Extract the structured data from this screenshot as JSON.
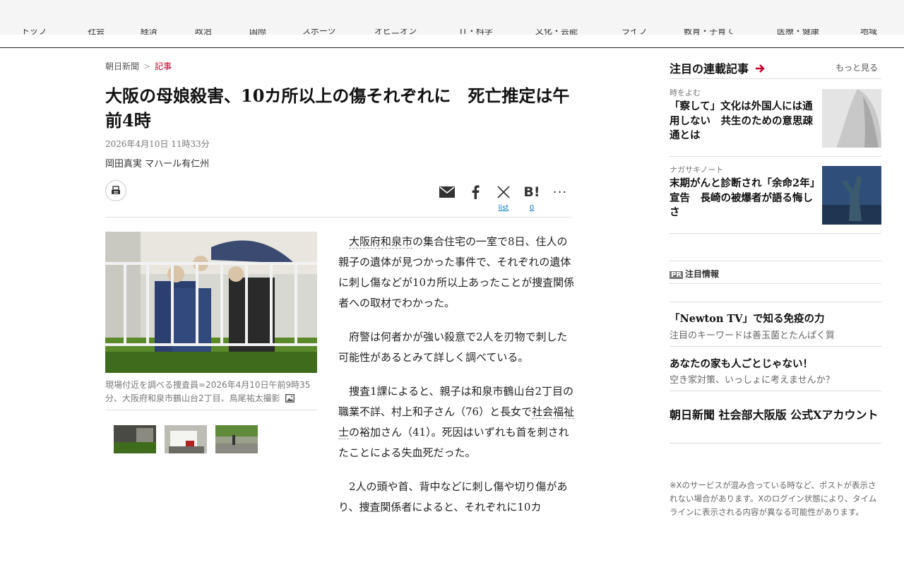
{
  "nav": {
    "items": [
      "トップ",
      "社会",
      "経済",
      "政治",
      "国際",
      "スポーツ",
      "オピニオン",
      "IT・科学",
      "文化・芸能",
      "ライフ",
      "教育・子育て",
      "医療・健康",
      "地域"
    ]
  },
  "breadcrumb": {
    "home": "朝日新聞",
    "separator": ">",
    "current": "記事"
  },
  "article": {
    "headline": "大阪の母娘殺害、10カ所以上の傷それぞれに　死亡推定は午前4時",
    "date": "2026年4月10日 11時33分",
    "authors": "岡田真実 マハール有仁州",
    "share": {
      "list_label": "list",
      "hatena_count": "0"
    },
    "photo_caption": "現場付近を調べる捜査員=2026年4月10日午前9時35分、大阪府和泉市鶴山台2丁目、鳥尾祐太撮影",
    "paragraphs": [
      {
        "link": "大阪府和泉市",
        "text": "の集合住宅の一室で8日、住人の親子の遺体が見つかった事件で、それぞれの遺体に刺し傷などが10カ所以上あったことが捜査関係者への取材でわかった。"
      },
      {
        "link": "",
        "text": "府警は何者かが強い殺意で2人を刃物で刺した可能性があるとみて詳しく調べている。"
      },
      {
        "pre": "捜査1課によると、親子は和泉市鶴山台2丁目の職業不詳、村上和子さん（76）と長女で",
        "link": "社会福祉士",
        "text": "の裕加さん（41）。死因はいずれも首を刺されたことによる失血死だった。"
      },
      {
        "link": "",
        "text": "2人の頭や首、背中などに刺し傷や切り傷があり、捜査関係者によると、それぞれに10カ"
      }
    ]
  },
  "sidebar": {
    "header": "注目の連載記事",
    "more": "もっと見る",
    "items": [
      {
        "kicker": "時をよむ",
        "title": "「察して」文化は外国人には通用しない　共生のための意思疎通とは"
      },
      {
        "kicker": "ナガサキノート",
        "title": "末期がんと診断され「余命2年」宣告　長崎の被爆者が語る悔しさ"
      }
    ],
    "pr_badge": "PR",
    "pr_label": "注目情報",
    "ads": [
      {
        "title": "「Newton TV」で知る免疫の力",
        "sub": "注目のキーワードは善玉菌とたんぱく質"
      },
      {
        "title": "あなたの家も人ごとじゃない！",
        "sub": "空き家対策、いっしょに考えませんか？"
      }
    ],
    "x_account": "朝日新聞 社会部大阪版 公式Xアカウント",
    "x_note": "※Xのサービスが混み合っている時など、ポストが表示されない場合があります。Xのログイン状態により、タイムラインに表示される内容が異なる可能性があります。"
  },
  "colors": {
    "accent": "#c4002b",
    "link": "#0075b8"
  },
  "icons": [
    "print-icon",
    "mail-icon",
    "facebook-icon",
    "x-icon",
    "hatena-icon",
    "more-icon",
    "arrow-right-icon",
    "photo-icon"
  ]
}
